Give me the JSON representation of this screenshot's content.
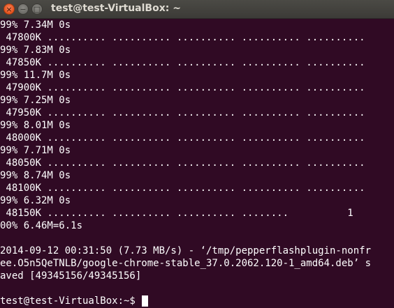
{
  "window": {
    "title": "test@test-VirtualBox: ~",
    "close_glyph": "×",
    "minimize_glyph": "−",
    "maximize_glyph": "□"
  },
  "terminal": {
    "lines": [
      "99% 7.34M 0s",
      " 47800K .......... .......... .......... .......... ..........",
      "99% 7.83M 0s",
      " 47850K .......... .......... .......... .......... ..........",
      "99% 11.7M 0s",
      " 47900K .......... .......... .......... .......... ..........",
      "99% 7.25M 0s",
      " 47950K .......... .......... .......... .......... ..........",
      "99% 8.01M 0s",
      " 48000K .......... .......... .......... .......... ..........",
      "99% 7.71M 0s",
      " 48050K .......... .......... .......... .......... ..........",
      "99% 8.74M 0s",
      " 48100K .......... .......... .......... .......... ..........",
      "99% 6.32M 0s",
      " 48150K .......... .......... .......... ........          1",
      "00% 6.46M=6.1s",
      "",
      "2014-09-12 00:31:50 (7.73 MB/s) - ‘/tmp/pepperflashplugin-nonfr",
      "ee.O5n5QeTNLB/google-chrome-stable_37.0.2062.120-1_amd64.deb’ s",
      "aved [49345156/49345156]",
      ""
    ],
    "prompt": "test@test-VirtualBox:~$"
  },
  "colors": {
    "background": "#300a24",
    "text": "#ffffff",
    "titlebar": "#3c3b37",
    "close_button": "#e5531c"
  }
}
